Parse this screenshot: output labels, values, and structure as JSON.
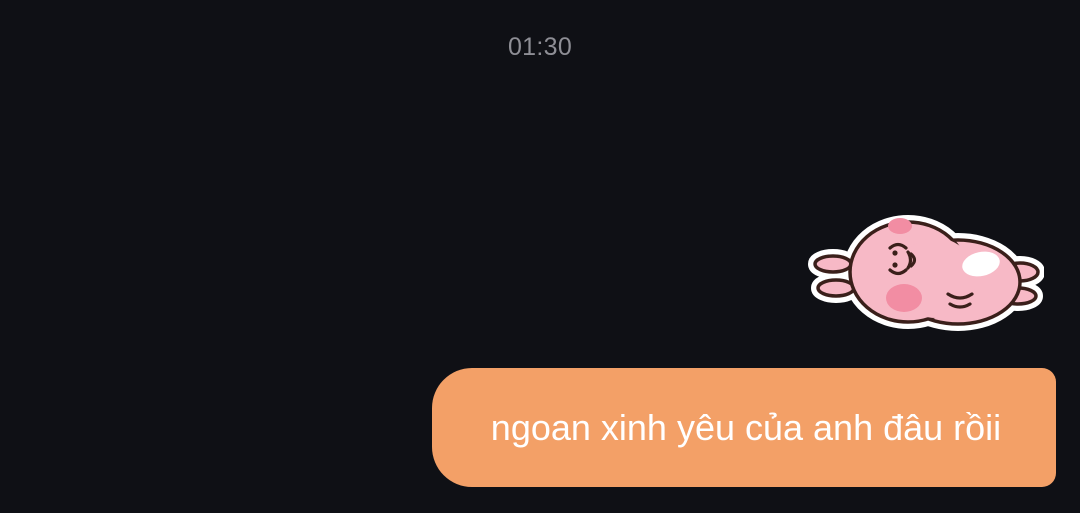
{
  "conversation": {
    "timestamp": "01:30",
    "sticker": {
      "icon": "pink-bunny-lying-sticker",
      "colors": {
        "body": "#f7b9c6",
        "cheek": "#f28da3",
        "outline": "#3a1f1a",
        "highlight": "#ffffff"
      }
    },
    "messages": [
      {
        "sender": "me",
        "text": "ngoan xinh yêu của anh đâu rồii",
        "bubble_color": "#f3a067"
      }
    ]
  },
  "theme": {
    "background": "#0f1015",
    "timestamp_color": "#8e8e95"
  }
}
